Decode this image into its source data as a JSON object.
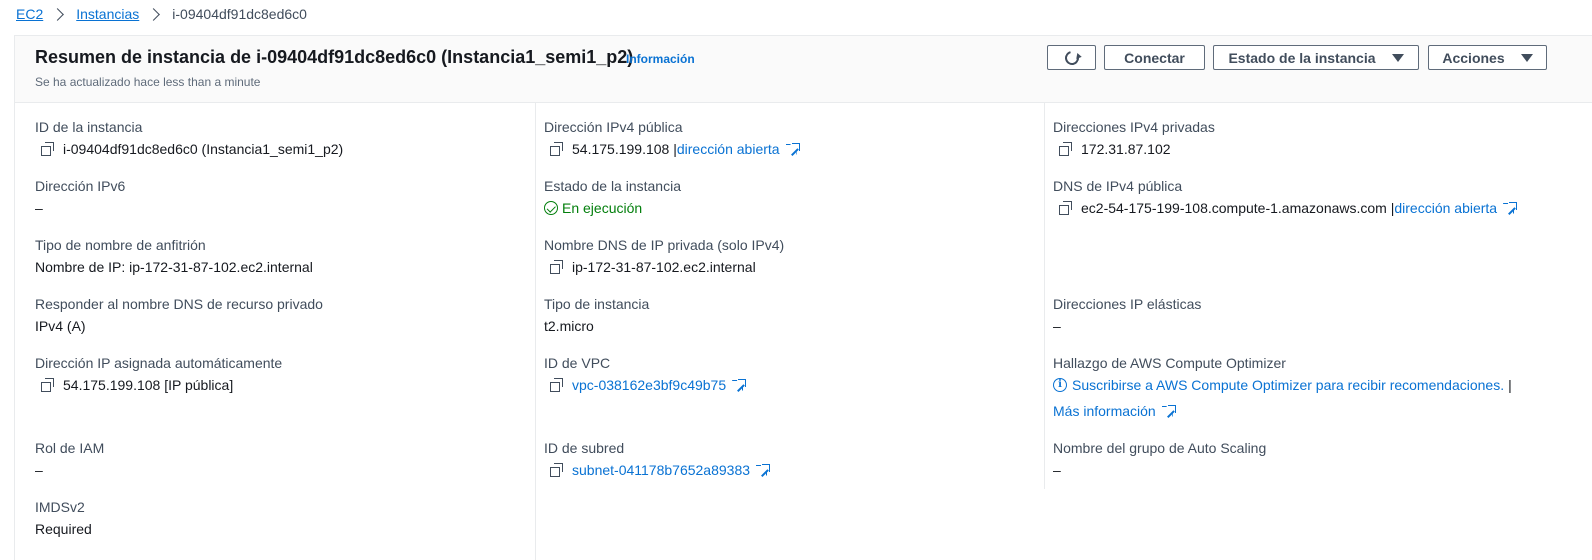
{
  "breadcrumb": {
    "items": [
      "EC2",
      "Instancias"
    ],
    "current": "i-09404df91dc8ed6c0"
  },
  "header": {
    "title": "Resumen de instancia de i-09404df91dc8ed6c0 (Instancia1_semi1_p2)",
    "info_link": "Información",
    "subtitle": "Se ha actualizado hace less than a minute",
    "buttons": {
      "connect": "Conectar",
      "instance_state": "Estado de la instancia",
      "actions": "Acciones"
    }
  },
  "fields": {
    "instance_id": {
      "label": "ID de la instancia",
      "value": "i-09404df91dc8ed6c0 (Instancia1_semi1_p2)"
    },
    "ipv6": {
      "label": "Dirección IPv6",
      "value": "–"
    },
    "hostname_type": {
      "label": "Tipo de nombre de anfitrión",
      "value": "Nombre de IP: ip-172-31-87-102.ec2.internal"
    },
    "private_dns_answer": {
      "label": "Responder al nombre DNS de recurso privado",
      "value": "IPv4 (A)"
    },
    "auto_ip": {
      "label": "Dirección IP asignada automáticamente",
      "value": "54.175.199.108 [IP pública]"
    },
    "iam_role": {
      "label": "Rol de IAM",
      "value": "–"
    },
    "imdsv2": {
      "label": "IMDSv2",
      "value": "Required"
    },
    "public_ipv4": {
      "label": "Dirección IPv4 pública",
      "value": "54.175.199.108 |",
      "link": "dirección abierta"
    },
    "instance_state": {
      "label": "Estado de la instancia",
      "value": "En ejecución"
    },
    "private_dns": {
      "label": "Nombre DNS de IP privada (solo IPv4)",
      "value": "ip-172-31-87-102.ec2.internal"
    },
    "instance_type": {
      "label": "Tipo de instancia",
      "value": "t2.micro"
    },
    "vpc_id": {
      "label": "ID de VPC",
      "value": "vpc-038162e3bf9c49b75"
    },
    "subnet_id": {
      "label": "ID de subred",
      "value": "subnet-041178b7652a89383"
    },
    "private_ipv4": {
      "label": "Direcciones IPv4 privadas",
      "value": "172.31.87.102"
    },
    "public_dns": {
      "label": "DNS de IPv4 pública",
      "value": "ec2-54-175-199-108.compute-1.amazonaws.com |",
      "link": "dirección abierta"
    },
    "elastic_ip": {
      "label": "Direcciones IP elásticas",
      "value": "–"
    },
    "optimizer": {
      "label": "Hallazgo de AWS Compute Optimizer",
      "link": "Suscribirse a AWS Compute Optimizer para recibir recomendaciones.",
      "separator": "|",
      "more": "Más información"
    },
    "asg": {
      "label": "Nombre del grupo de Auto Scaling",
      "value": "–"
    }
  },
  "colors": {
    "link": "#0972d3",
    "success": "#037f0c",
    "text": "#16191f",
    "label": "#414d5c"
  }
}
